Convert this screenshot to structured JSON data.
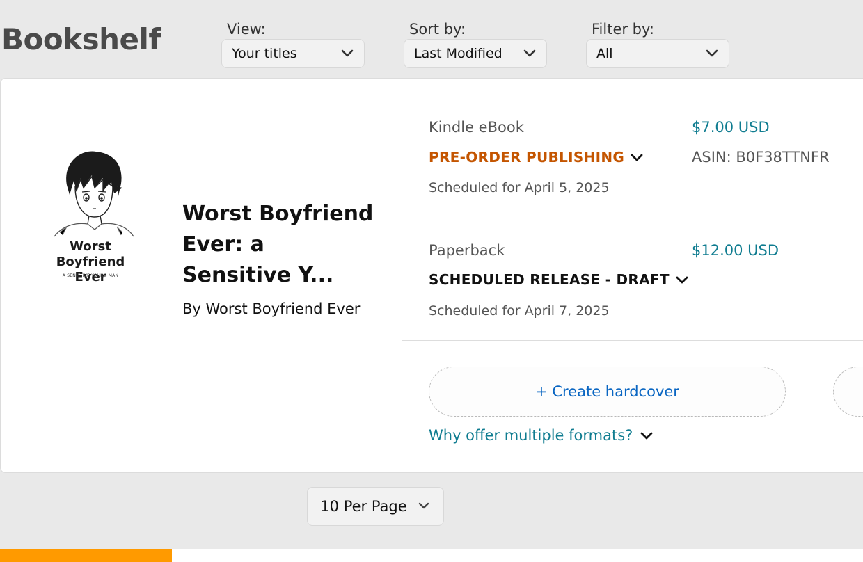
{
  "header": {
    "title": "Bookshelf",
    "view": {
      "label": "View:",
      "value": "Your titles"
    },
    "sort": {
      "label": "Sort by:",
      "value": "Last Modified"
    },
    "filter": {
      "label": "Filter by:",
      "value": "All"
    }
  },
  "book": {
    "title": "Worst Boyfriend Ever: a Sensitive Y...",
    "author": "By Worst Boyfriend Ever",
    "cover": {
      "title": "Worst Boyfriend Ever",
      "subtitle": "A SENSITIVE YOUNG MAN"
    },
    "formats": [
      {
        "name": "Kindle eBook",
        "status": "PRE-ORDER PUBLISHING",
        "status_color": "#c45500",
        "scheduled": "Scheduled for April 5, 2025",
        "price": "$7.00 USD",
        "asin": "ASIN: B0F38TTNFR"
      },
      {
        "name": "Paperback",
        "status": "SCHEDULED RELEASE - DRAFT",
        "status_color": "#111111",
        "scheduled": "Scheduled for April 7, 2025",
        "price": "$12.00 USD"
      }
    ],
    "create_hardcover": "+ Create hardcover",
    "why_link": "Why offer multiple formats?"
  },
  "pagination": {
    "per_page": "10 Per Page"
  },
  "colors": {
    "accent_orange": "#c45500",
    "link_teal": "#0f7c90",
    "link_blue": "#0a66c2",
    "brand_orange": "#ff9a00"
  }
}
